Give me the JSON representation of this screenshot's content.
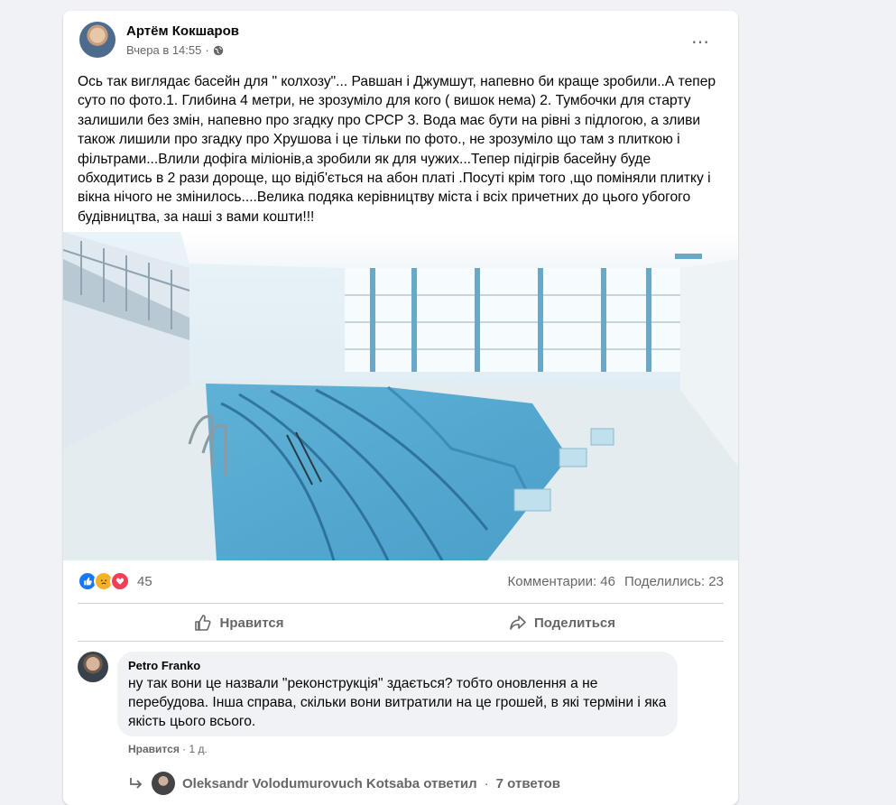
{
  "post": {
    "author": "Артём Кокшаров",
    "time": "Вчера в 14:55",
    "dot": "·",
    "text": "Ось так  виглядає басейн для \" колхозу\"... Равшан і Джумшут, напевно би краще зробили..А тепер суто по фото.1. Глибина 4 метри, не зрозуміло для кого ( вишок нема)  2. Тумбочки для старту залишили без змін, напевно про згадку про СРСР 3. Вода має бути на рівні з підлогою, а зливи також лишили про згадку про Хрушова і це тільки по фото., не зрозуміло що там з плиткою і фільтрами...Влили дофіга міліонів,а зробили як для чужих...Тепер підігрів басейну буде обходитись в 2 рази дороще, що відіб'ється на абон платі .Посуті крім того ,що поміняли плитку і вікна нічого не змінилось....Велика подяка керівництву міста і всіх причетних до цього убогого будівництва, за наші з вами кошти!!!",
    "more_icon": "⋯"
  },
  "reactions": {
    "count": "45",
    "icons": [
      "like-icon",
      "sad-icon",
      "love-icon"
    ],
    "comments": "Комментарии: 46",
    "shares": "Поделились: 23"
  },
  "actions": {
    "like_label": "Нравится",
    "share_label": "Поделиться"
  },
  "comment": {
    "author": "Petro Franko",
    "text": "ну так вони це назвали \"реконструкція\" здається? тобто оновлення а не перебудова. Інша справа, скільки вони витратили на це грошей, в які терміни і яка якість цього всього.",
    "like_label": "Нравится",
    "dot": "·",
    "age": "1 д."
  },
  "reply": {
    "text": "Oleksandr Volodumurovuch Kotsaba ответил",
    "dot": "·",
    "count": "7 ответов"
  },
  "colors": {
    "background": "#f0f2f5",
    "card": "#ffffff",
    "secondary_text": "#65676b",
    "like_blue": "#1877f2",
    "love_red": "#f33e58",
    "sad_yellow": "#f7b125"
  }
}
